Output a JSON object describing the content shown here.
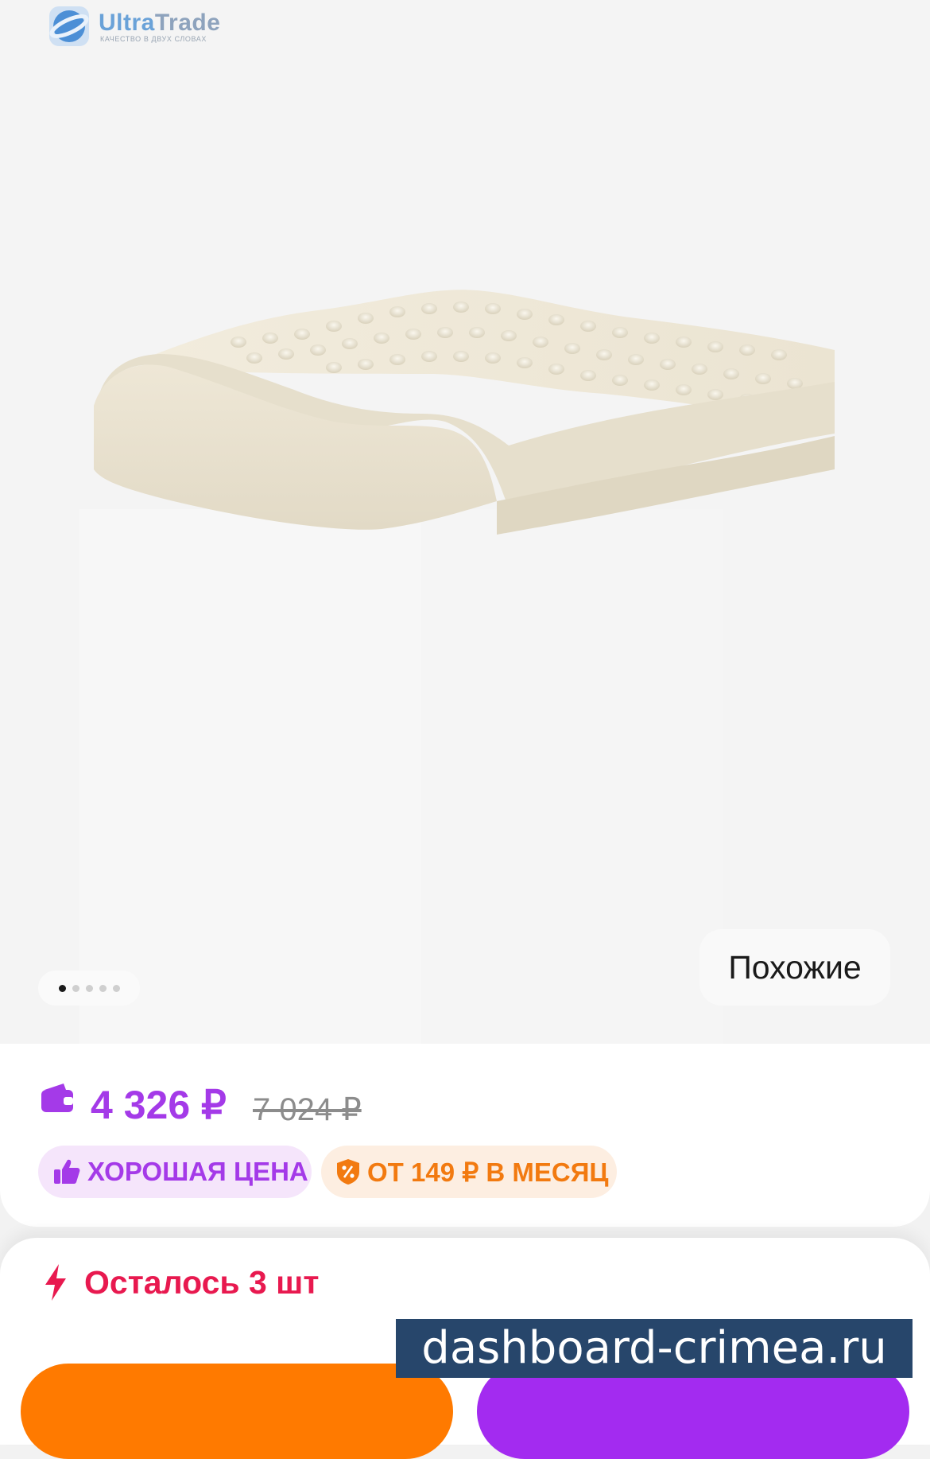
{
  "brand": {
    "name_part1": "Ultra",
    "name_part2": "Trade",
    "tagline": "КАЧЕСТВО В ДВУХ СЛОВАХ"
  },
  "gallery": {
    "similar_label": "Похожие",
    "dots_total": 5,
    "active_dot": 1
  },
  "price": {
    "current": "4 326 ₽",
    "old": "7 024 ₽",
    "badges": [
      {
        "label": "ХОРОШАЯ ЦЕНА",
        "icon": "thumbs-up-icon"
      },
      {
        "label": "ОТ 149 ₽ В МЕСЯЦ",
        "icon": "shield-percent-icon"
      }
    ]
  },
  "stock": {
    "label": "Осталось 3 шт",
    "icon": "lightning-icon"
  },
  "watermark": "dashboard-crimea.ru",
  "colors": {
    "accent_purple": "#a43ae8",
    "accent_orange": "#ff7a00",
    "stock_red": "#e8194f",
    "watermark_bg": "#27466b"
  }
}
